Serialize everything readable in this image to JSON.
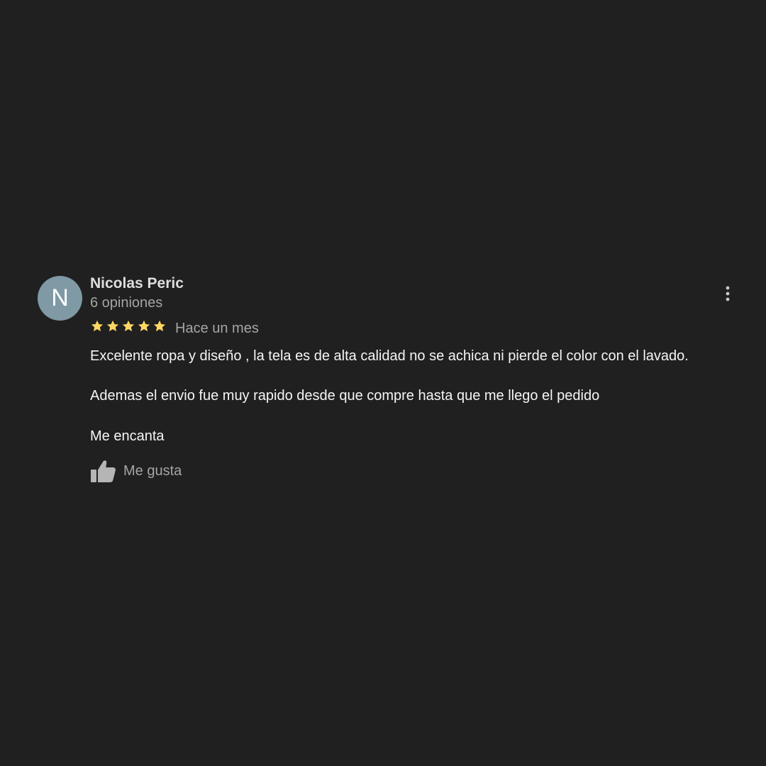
{
  "review": {
    "avatar_initial": "N",
    "author": "Nicolas Peric",
    "review_count": "6 opiniones",
    "rating": 5,
    "rating_max": 5,
    "date": "Hace un mes",
    "text": {
      "line1": "Excelente ropa y diseño , la tela es de alta calidad no se achica ni pierde el color con el lavado.",
      "line2": "Ademas el envio fue muy rapido desde que compre hasta que me llego el pedido",
      "line3": "Me encanta"
    },
    "like_label": "Me gusta",
    "star_color": "#fdd663",
    "more_icon": "more-vertical-icon",
    "like_icon": "thumb-up-icon"
  }
}
